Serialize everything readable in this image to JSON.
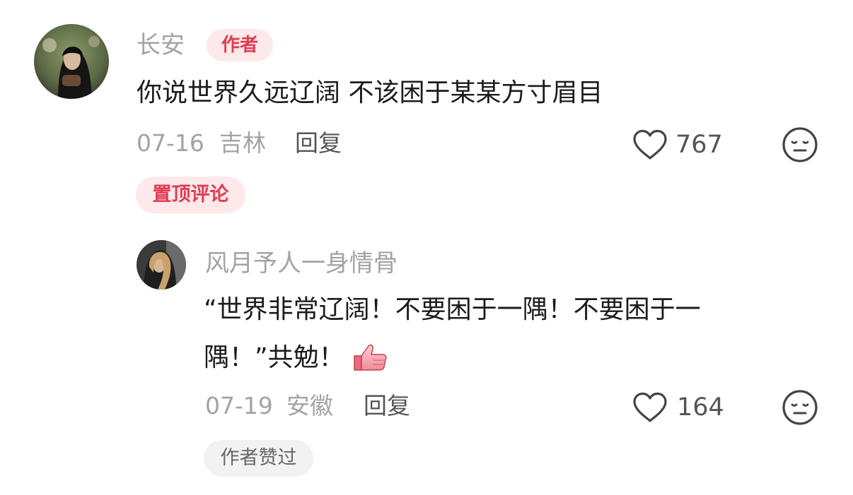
{
  "comment": {
    "username": "长安",
    "author_badge": "作者",
    "text": "你说世界久远辽阔 不该困于某某方寸眉目",
    "date": "07-16",
    "location": "吉林",
    "reply_label": "回复",
    "like_count": "767",
    "pinned_label": "置顶评论",
    "icons": {
      "like": "heart-outline-icon",
      "dislike": "neutral-face-icon"
    }
  },
  "reply": {
    "username": "风月予人一身情骨",
    "text_line1": "“世界非常辽阔！不要困于一隅！不要困于一",
    "text_line2": "隅！”共勉！",
    "emoji": "thumbs-up-emoji",
    "date": "07-19",
    "location": "安徽",
    "reply_label": "回复",
    "like_count": "164",
    "author_liked_label": "作者赞过",
    "icons": {
      "like": "heart-outline-icon",
      "dislike": "neutral-face-icon"
    }
  },
  "colors": {
    "accent": "#e03c52",
    "accent_bg": "#fde8ea",
    "muted_text": "#a3a3a3",
    "pill_bg": "#f2f2f2"
  }
}
